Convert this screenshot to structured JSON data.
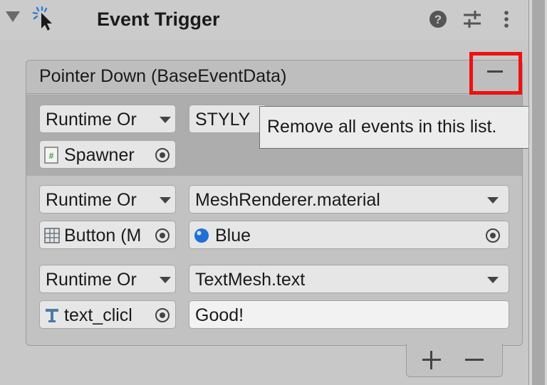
{
  "component": {
    "title": "Event Trigger",
    "icon": "event-trigger-icon"
  },
  "header_buttons": [
    "help-icon",
    "presets-icon",
    "more-menu-icon"
  ],
  "event": {
    "title": "Pointer Down (BaseEventData)",
    "entries": [
      {
        "mode": "Runtime Or",
        "function": "STYLY",
        "object": "Spawner",
        "object_icon": "script-icon",
        "argument": ""
      },
      {
        "mode": "Runtime Or",
        "function": "MeshRenderer.material",
        "object": "Button (M",
        "object_icon": "mesh-icon",
        "argument": "Blue",
        "argument_icon": "material-sphere-icon"
      },
      {
        "mode": "Runtime Or",
        "function": "TextMesh.text",
        "object": "text_clicl",
        "object_icon": "text-mesh-icon",
        "argument": "Good!"
      }
    ]
  },
  "tooltip": "Remove all events in this list.",
  "colors": {
    "highlight": "#ee1111",
    "material_blue": "#1f6fd6"
  }
}
